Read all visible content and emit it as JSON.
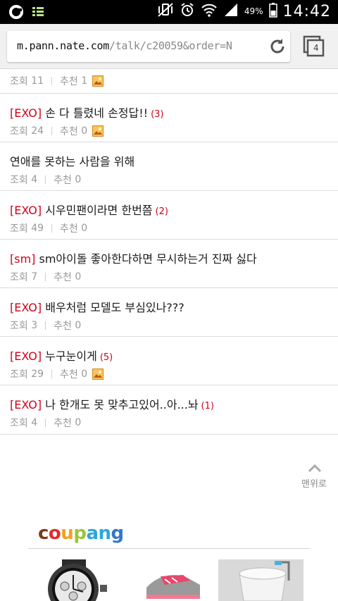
{
  "status_bar": {
    "battery_percent": "49%",
    "time": "14:42",
    "icons": [
      "browser-o-icon",
      "media-notification-icon",
      "mute-vibrate-icon",
      "alarm-icon",
      "wifi-icon",
      "signal-icon",
      "battery-icon"
    ]
  },
  "browser": {
    "url_host": "m.pann.nate.com",
    "url_path": "/talk/c20059&order=N",
    "tab_count": "4",
    "colors": {
      "url_bar_bg": "#f1f1f1",
      "tag": "#d0021b",
      "meta": "#999999"
    }
  },
  "posts": [
    {
      "tag": "",
      "title": "",
      "comments": "",
      "views_label": "조회",
      "views": "11",
      "rec_label": "추천",
      "rec": "1",
      "has_image": true
    },
    {
      "tag": "[EXO]",
      "title": "손 다 틀렸네 손정답!!",
      "comments": "(3)",
      "views_label": "조회",
      "views": "24",
      "rec_label": "추천",
      "rec": "0",
      "has_image": true
    },
    {
      "tag": "",
      "title": "연애를 못하는 사람을 위해",
      "comments": "",
      "views_label": "조회",
      "views": "4",
      "rec_label": "추천",
      "rec": "0",
      "has_image": false
    },
    {
      "tag": "[EXO]",
      "title": "시우민팬이라면 한번쯤",
      "comments": "(2)",
      "views_label": "조회",
      "views": "49",
      "rec_label": "추천",
      "rec": "0",
      "has_image": false
    },
    {
      "tag": "[sm]",
      "title": "sm아이돌 좋아한다하면 무시하는거 진짜 싫다",
      "comments": "",
      "views_label": "조회",
      "views": "7",
      "rec_label": "추천",
      "rec": "0",
      "has_image": false
    },
    {
      "tag": "[EXO]",
      "title": "배우처럼 모델도 부심있나???",
      "comments": "",
      "views_label": "조회",
      "views": "3",
      "rec_label": "추천",
      "rec": "0",
      "has_image": false
    },
    {
      "tag": "[EXO]",
      "title": "누구눈이게",
      "comments": "(5)",
      "views_label": "조회",
      "views": "29",
      "rec_label": "추천",
      "rec": "0",
      "has_image": true
    },
    {
      "tag": "[EXO]",
      "title": "나 한개도 못 맞추고있어..아...놔",
      "comments": "(1)",
      "views_label": "조회",
      "views": "4",
      "rec_label": "추천",
      "rec": "0",
      "has_image": false
    }
  ],
  "to_top": {
    "label": "맨위로"
  },
  "ad": {
    "brand_letters": [
      {
        "ch": "c",
        "color": "#7a3b1f"
      },
      {
        "ch": "o",
        "color": "#e32c2c"
      },
      {
        "ch": "u",
        "color": "#f2a11a"
      },
      {
        "ch": "p",
        "color": "#9cc43b"
      },
      {
        "ch": "a",
        "color": "#2aa6df"
      },
      {
        "ch": "n",
        "color": "#2aa6df"
      },
      {
        "ch": "g",
        "color": "#3477c9"
      }
    ],
    "products": [
      "watch-product-image",
      "sneaker-product-image",
      "bucket-product-image"
    ]
  }
}
